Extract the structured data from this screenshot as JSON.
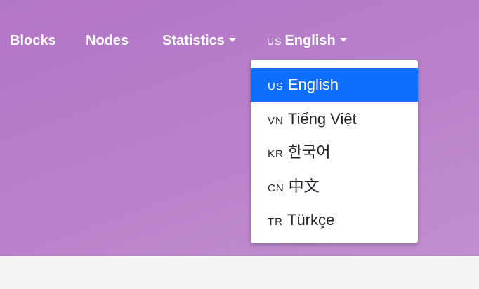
{
  "navbar": {
    "items": [
      {
        "label": "Blocks"
      },
      {
        "label": "Nodes"
      },
      {
        "label": "Statistics"
      }
    ],
    "language": {
      "flag": "us",
      "label": "English"
    }
  },
  "language_menu": {
    "items": [
      {
        "flag": "us",
        "label": "English",
        "active": true
      },
      {
        "flag": "vn",
        "label": "Tiếng Việt",
        "active": false
      },
      {
        "flag": "kr",
        "label": "한국어",
        "active": false
      },
      {
        "flag": "cn",
        "label": "中文",
        "active": false
      },
      {
        "flag": "tr",
        "label": "Türkçe",
        "active": false
      }
    ]
  },
  "colors": {
    "hero": "#b87dc9",
    "active_item": "#0d6efd",
    "page_bg": "#f5f5f5"
  }
}
